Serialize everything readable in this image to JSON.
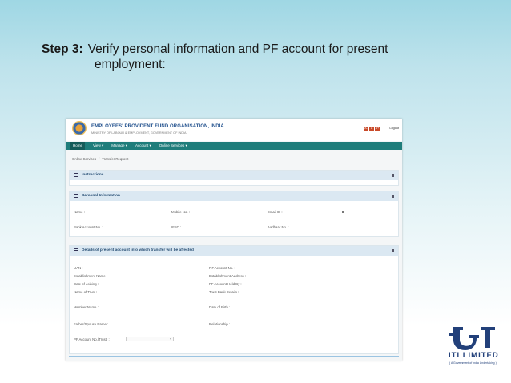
{
  "slide": {
    "step_label": "Step 3:",
    "step_text_line1": "Verify personal information and PF account for present",
    "step_text_line2": "employment:"
  },
  "portal": {
    "org_name": "EMPLOYEES' PROVIDENT FUND ORGANISATION, INDIA",
    "ministry": "MINISTRY OF LABOUR & EMPLOYMENT, GOVERNMENT OF INDIA",
    "font_buttons": [
      "A-",
      "A",
      "A+"
    ],
    "logout": "Logout",
    "nav": [
      "Home",
      "View ▾",
      "Manage ▾",
      "Account ▾",
      "Online Services ▾"
    ],
    "breadcrumb": [
      "Online Services",
      "Transfer Request"
    ],
    "panels": {
      "instructions": "Instructions",
      "personal": "Personal Information",
      "present_account": "Details of present account into which transfer will be affected"
    },
    "personal_fields": {
      "name": "Name :",
      "mobile": "Mobile No. :",
      "email": "Email ID :",
      "bank": "Bank Account No. :",
      "ifsc": "IFSC :",
      "aadhaar": "Aadhaar No. :"
    },
    "present_fields": {
      "uan": "UAN :",
      "pf_account": "P.F.Account No. :",
      "est_name": "Establishment Name :",
      "est_address": "Establishment Address :",
      "doj": "Date of Joining :",
      "pf_held_by": "PF Account Held By :",
      "trust_name": "Name of Trust :",
      "trust_bank": "Trust Bank Details :",
      "member_name": "Member Name :",
      "dob": "Date of Birth :",
      "father": "Father/Spouse Name :",
      "relationship": "Relationship :",
      "pf_trust": "PF Account No.(Trust) :"
    }
  },
  "branding": {
    "company": "ITI LIMITED",
    "tagline": "( A Government of India Undertaking )",
    "brand_color": "#22407a"
  }
}
